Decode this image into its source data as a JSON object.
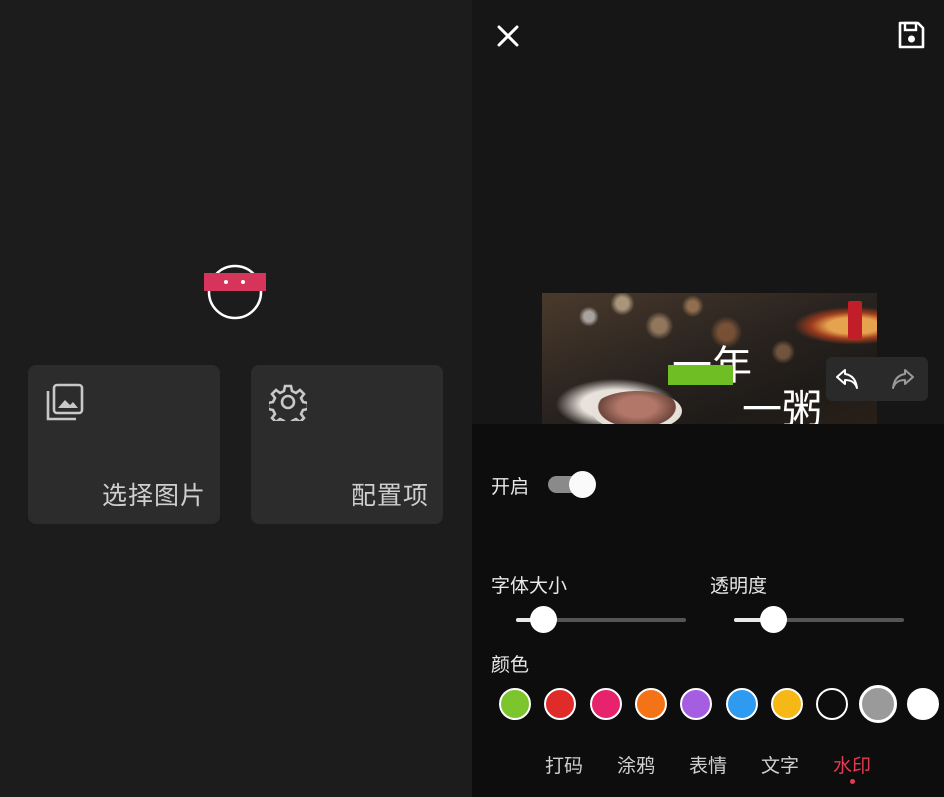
{
  "left_screen": {
    "cards": [
      {
        "label": "选择图片",
        "icon": "image-gallery-icon"
      },
      {
        "label": "配置项",
        "icon": "gear-icon"
      }
    ],
    "logo_icon": "face-logo-icon"
  },
  "editor": {
    "close_icon": "close-icon",
    "save_icon": "save-icon",
    "undo_icon": "undo-icon",
    "redo_icon": "redo-icon",
    "preview": {
      "caption_line1": "一年",
      "caption_line2": "一粥"
    },
    "watermark": {
      "enable_label": "开启",
      "enabled": true,
      "font_size_label": "字体大小",
      "font_size_value": 0.16,
      "opacity_label": "透明度",
      "opacity_value": 0.23,
      "color_label": "颜色",
      "colors": [
        "#7dc52d",
        "#e02b2b",
        "#e8236e",
        "#f37316",
        "#a55de1",
        "#2f9bf0",
        "#f5b816",
        "#0d0d0d",
        "#9a9a9a",
        "#ffffff"
      ],
      "selected_color_index": 8
    },
    "tabs": [
      "打码",
      "涂鸦",
      "表情",
      "文字",
      "水印"
    ],
    "active_tab_index": 4,
    "colors": {
      "accent": "#e53a52",
      "panel_bg": "#0d0d0d"
    }
  }
}
